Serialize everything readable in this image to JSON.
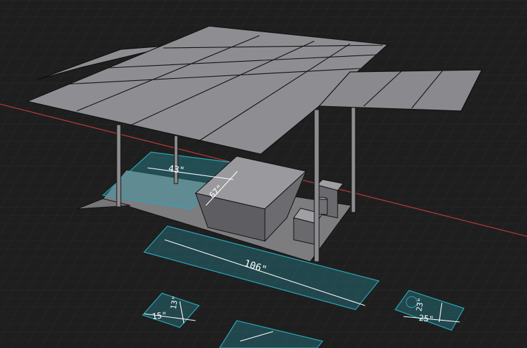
{
  "viewport": {
    "background_color": "#1e1e1e",
    "grid_color": "#2f2f2f",
    "axis_color": "#b43a3a",
    "model_color": "#8d8d91",
    "outline_color": "#0f0f0f",
    "footprint_color": "#2aa6b8",
    "dimension_color": "#ffffff"
  },
  "dimensions": {
    "width_43": "43\"",
    "height_67": "67\"",
    "length_106": "106\"",
    "left_15": "15\"",
    "left_13": "13\"",
    "right_23": "23\"",
    "right_25": "25\""
  }
}
